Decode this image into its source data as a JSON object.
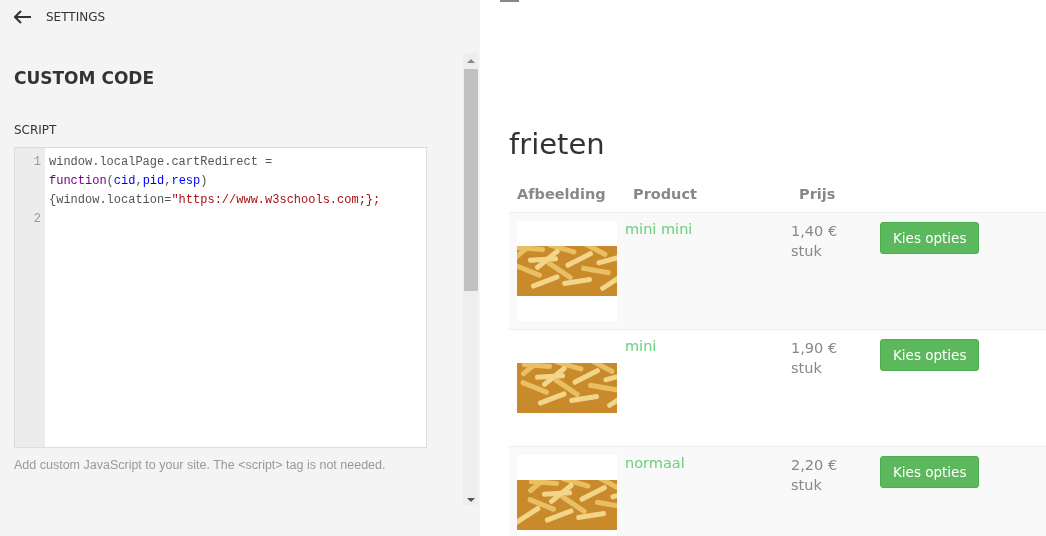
{
  "settings": {
    "back_label": "SETTINGS",
    "title": "CUSTOM CODE",
    "field_label": "SCRIPT",
    "code_lines": [
      {
        "number": "1",
        "tokens": [
          {
            "kind": "plain",
            "text": "window.localPage.cartRedirect = "
          },
          {
            "kind": "keyword",
            "text": "function"
          },
          {
            "kind": "plain",
            "text": "("
          },
          {
            "kind": "variable",
            "text": "cid"
          },
          {
            "kind": "plain",
            "text": ","
          },
          {
            "kind": "variable",
            "text": "pid"
          },
          {
            "kind": "plain",
            "text": ","
          },
          {
            "kind": "variable",
            "text": "resp"
          },
          {
            "kind": "plain",
            "text": ") {window.location="
          },
          {
            "kind": "string",
            "text": "\"https://www.w3schools.com;};"
          }
        ]
      },
      {
        "number": "2"
      }
    ],
    "help_text": "Add custom JavaScript to your site. The <script> tag is not needed."
  },
  "preview": {
    "heading": "frieten",
    "columns": [
      "Afbeelding",
      "Product",
      "Prijs"
    ],
    "rows": [
      {
        "product": "mini mini",
        "price": "1,40 €",
        "unit": "stuk",
        "button": "Kies opties"
      },
      {
        "product": "mini",
        "price": "1,90 €",
        "unit": "stuk",
        "button": "Kies opties"
      },
      {
        "product": "normaal",
        "price": "2,20 €",
        "unit": "stuk",
        "button": "Kies opties"
      }
    ]
  }
}
